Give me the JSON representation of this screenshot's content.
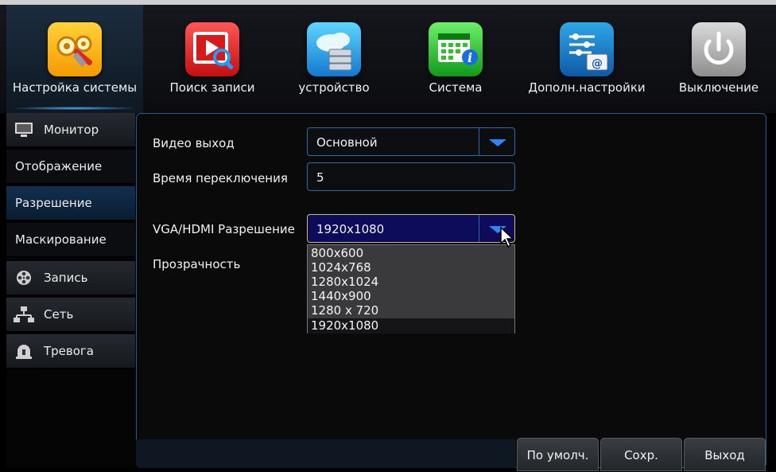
{
  "topmenu": [
    {
      "label": "Настройка системы",
      "icon": "settings-gears-icon"
    },
    {
      "label": "Поиск записи",
      "icon": "video-search-icon"
    },
    {
      "label": "устройство",
      "icon": "cloud-storage-icon"
    },
    {
      "label": "Система",
      "icon": "calendar-info-icon"
    },
    {
      "label": "Дополн.настройки",
      "icon": "advanced-settings-icon"
    },
    {
      "label": "Выключение",
      "icon": "power-icon"
    }
  ],
  "sidebar": {
    "items": [
      {
        "label": "Монитор",
        "icon": "monitor-icon"
      },
      {
        "label": "Отображение"
      },
      {
        "label": "Разрешение"
      },
      {
        "label": "Маскирование"
      },
      {
        "label": "Запись",
        "icon": "film-reel-icon"
      },
      {
        "label": "Сеть",
        "icon": "network-icon"
      },
      {
        "label": "Тревога",
        "icon": "alarm-icon"
      }
    ]
  },
  "form": {
    "video_output": {
      "label": "Видео выход",
      "value": "Основной"
    },
    "switch_time": {
      "label": "Время переключения",
      "value": "5"
    },
    "resolution": {
      "label": "VGA/HDMI Разрешение",
      "value": "1920x1080"
    },
    "transparency": {
      "label": "Прозрачность"
    }
  },
  "resolution_options": [
    "800x600",
    "1024x768",
    "1280x1024",
    "1440x900",
    "1280 x 720",
    "1920x1080"
  ],
  "buttons": {
    "default": "По умолч.",
    "save": "Сохр.",
    "exit": "Выход"
  },
  "colors": {
    "accent": "#2e86ff",
    "active_tab": "#112f4d",
    "focused_field": "#0c0c5a"
  }
}
